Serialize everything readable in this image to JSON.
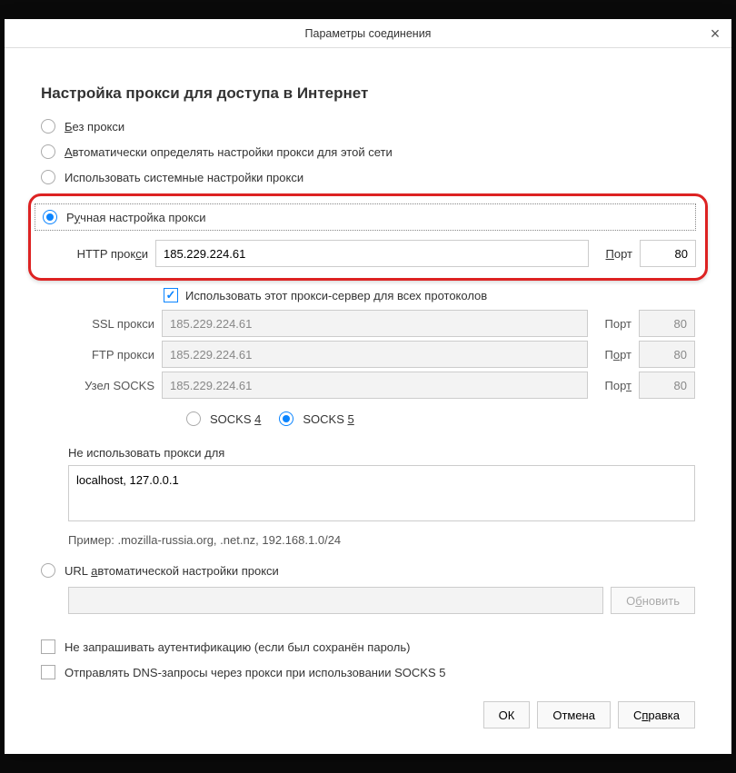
{
  "dialog": {
    "title": "Параметры соединения",
    "close_label": "×"
  },
  "section_title": "Настройка прокси для доступа в Интернет",
  "radios": {
    "no_proxy": "Без прокси",
    "auto_detect": "Автоматически определять настройки прокси для этой сети",
    "system": "Использовать системные настройки прокси",
    "manual": "Ручная настройка прокси",
    "pac": "URL автоматической настройки прокси"
  },
  "proxy": {
    "http_label": "HTTP прокси",
    "ssl_label": "SSL прокси",
    "ftp_label": "FTP прокси",
    "socks_label": "Узел SOCKS",
    "port_label": "Порт",
    "host": "185.229.224.61",
    "port": "80",
    "use_for_all": "Использовать этот прокси-сервер для всех протоколов",
    "socks4": "SOCKS 4",
    "socks5": "SOCKS 5"
  },
  "noproxy": {
    "label": "Не использовать прокси для",
    "list": "localhost, 127.0.0.1",
    "example": "Пример: .mozilla-russia.org, .net.nz, 192.168.1.0/24"
  },
  "pac": {
    "url": "",
    "reload": "Обновить"
  },
  "bottom": {
    "no_auth_prompt": "Не запрашивать аутентификацию (если был сохранён пароль)",
    "dns_socks5": "Отправлять DNS-запросы через прокси при использовании SOCKS 5"
  },
  "footer": {
    "ok": "ОК",
    "cancel": "Отмена",
    "help": "Справка"
  }
}
